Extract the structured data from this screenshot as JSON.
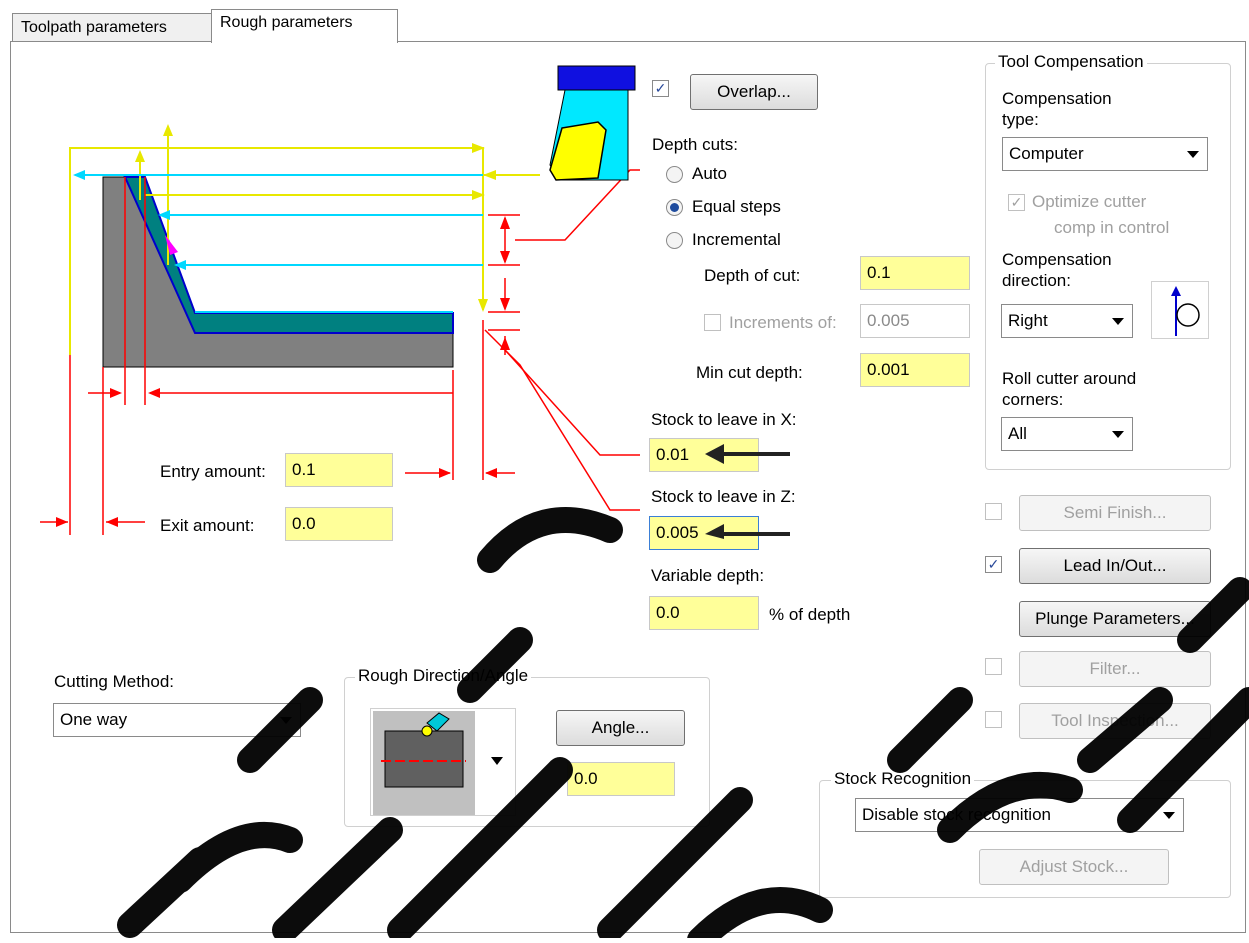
{
  "tabs": [
    "Toolpath parameters",
    "Rough parameters"
  ],
  "overlap": {
    "checked": true,
    "label": "Overlap..."
  },
  "depth_cuts": {
    "label": "Depth cuts:",
    "options": [
      "Auto",
      "Equal steps",
      "Incremental"
    ],
    "selected": "Equal steps",
    "depth_of_cut_label": "Depth of cut:",
    "depth_of_cut_value": "0.1",
    "increments_label": "Increments of:",
    "increments_value": "0.005",
    "min_cut_depth_label": "Min cut depth:",
    "min_cut_depth_value": "0.001"
  },
  "stock": {
    "x_label": "Stock to leave in X:",
    "x_value": "0.01",
    "z_label": "Stock to leave in Z:",
    "z_value": "0.005",
    "variable_label": "Variable depth:",
    "variable_value": "0.0",
    "variable_unit": "% of depth"
  },
  "entry": {
    "label": "Entry amount:",
    "value": "0.1"
  },
  "exit": {
    "label": "Exit amount:",
    "value": "0.0"
  },
  "cutting_method": {
    "label": "Cutting Method:",
    "value": "One way"
  },
  "rough_direction": {
    "title": "Rough Direction/Angle",
    "angle_button": "Angle...",
    "angle_value": "0.0"
  },
  "tool_comp": {
    "title": "Tool Compensation",
    "type_label": "Compensation type:",
    "type_value": "Computer",
    "optimize_label_1": "Optimize cutter",
    "optimize_label_2": "comp in control",
    "direction_label": "Compensation direction:",
    "direction_value": "Right",
    "roll_label": "Roll cutter around corners:",
    "roll_value": "All"
  },
  "buttons": {
    "semi_finish": "Semi Finish...",
    "lead_in_out": "Lead In/Out...",
    "plunge": "Plunge Parameters...",
    "filter": "Filter...",
    "tool_inspection": "Tool Inspection..."
  },
  "stock_recognition": {
    "title": "Stock Recognition",
    "value": "Disable stock recognition",
    "adjust_button": "Adjust Stock..."
  },
  "colors": {
    "field_yellow": "#ffff99",
    "diagram_red": "#ff0000",
    "diagram_cyan": "#00e0ff",
    "diagram_yellow": "#f0f000",
    "part_gray": "#808080",
    "stock_teal": "#008080"
  }
}
